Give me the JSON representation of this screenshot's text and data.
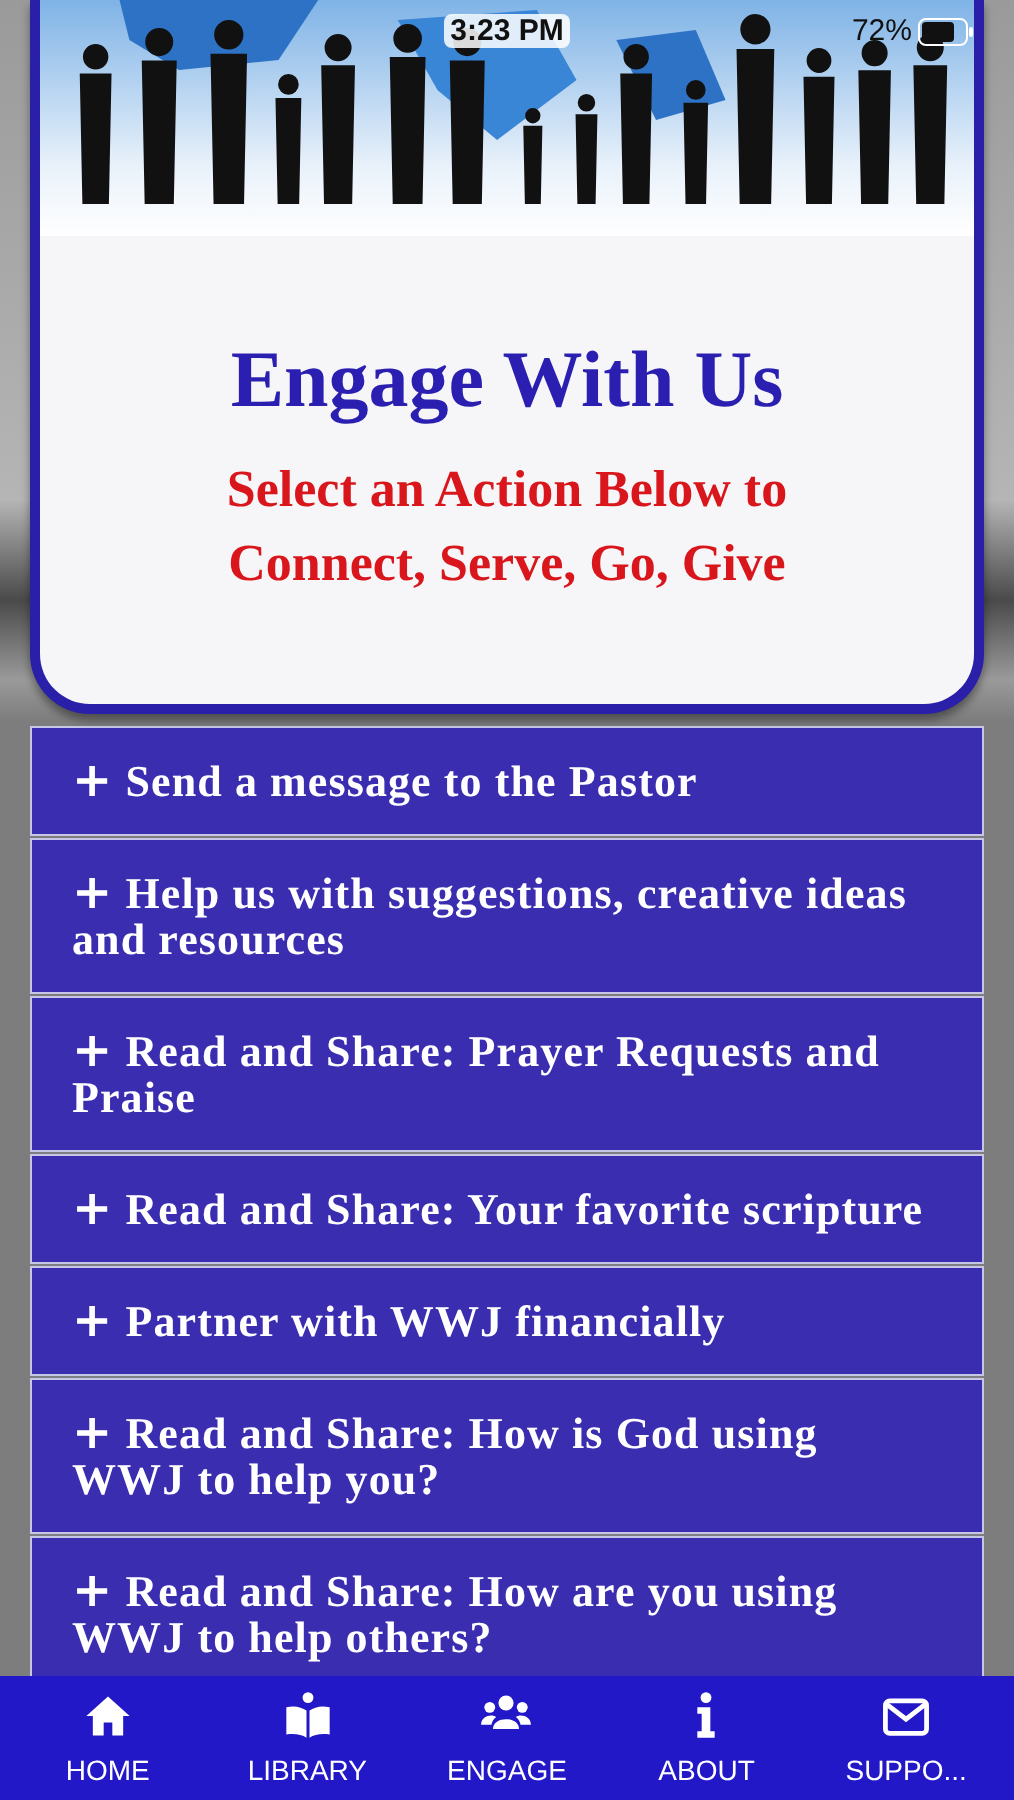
{
  "status_bar": {
    "time": "3:23 PM",
    "battery": "72%"
  },
  "header": {
    "title": "Engage With Us",
    "subtitle": "Select an Action Below to Connect, Serve, Go, Give"
  },
  "actions": [
    {
      "icon": "+",
      "label": "Send a message to the Pastor"
    },
    {
      "icon": "+",
      "label": "Help us with suggestions, creative ideas and resources"
    },
    {
      "icon": "+",
      "label": "Read and Share: Prayer Requests and Praise"
    },
    {
      "icon": "+",
      "label": "Read and Share: Your favorite scripture"
    },
    {
      "icon": "+",
      "label": "Partner with WWJ financially"
    },
    {
      "icon": "+",
      "label": "Read and Share: How is God using WWJ to help you?"
    },
    {
      "icon": "+",
      "label": "Read and Share: How are you using WWJ to help others?"
    }
  ],
  "tab_bar": [
    {
      "kind": "home",
      "label": "HOME"
    },
    {
      "kind": "library",
      "label": "LIBRARY"
    },
    {
      "kind": "engage",
      "label": "ENGAGE"
    },
    {
      "kind": "about",
      "label": "ABOUT"
    },
    {
      "kind": "support",
      "label": "SUPPO..."
    }
  ]
}
